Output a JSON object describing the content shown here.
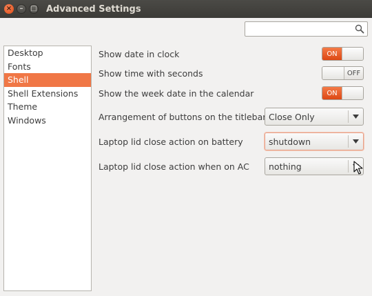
{
  "window": {
    "title": "Advanced Settings"
  },
  "search": {
    "value": "",
    "placeholder": ""
  },
  "sidebar": {
    "items": [
      {
        "label": "Desktop"
      },
      {
        "label": "Fonts"
      },
      {
        "label": "Shell",
        "selected": true
      },
      {
        "label": "Shell Extensions"
      },
      {
        "label": "Theme"
      },
      {
        "label": "Windows"
      }
    ]
  },
  "settings": {
    "date_in_clock": {
      "label": "Show date in clock",
      "state": "ON"
    },
    "time_seconds": {
      "label": "Show time with seconds",
      "state": "OFF"
    },
    "week_date": {
      "label": "Show the week date in the calendar",
      "state": "ON"
    },
    "titlebar_buttons": {
      "label": "Arrangement of buttons on the titlebar",
      "value": "Close Only"
    },
    "lid_battery": {
      "label": "Laptop lid close action on battery",
      "value": "shutdown"
    },
    "lid_ac": {
      "label": "Laptop lid close action when on AC",
      "value": "nothing"
    }
  },
  "colors": {
    "accent": "#f07746",
    "titlebar": "#3c3b37"
  },
  "icons": {
    "close": "close-icon",
    "minimize": "minimize-icon",
    "maximize": "maximize-icon",
    "search": "search-icon",
    "dropdown": "chevron-down-icon"
  }
}
